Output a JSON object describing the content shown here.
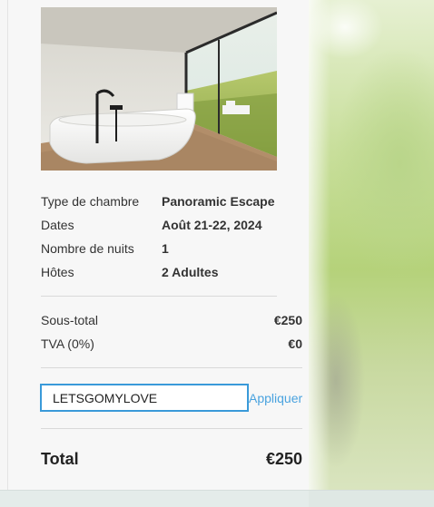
{
  "room": {
    "image_alt": "",
    "details": [
      {
        "label": "Type de chambre",
        "value": "Panoramic Escape"
      },
      {
        "label": "Dates",
        "value": "Août 21-22, 2024"
      },
      {
        "label": "Nombre de nuits",
        "value": "1"
      },
      {
        "label": "Hôtes",
        "value": "2 Adultes"
      }
    ]
  },
  "summary": {
    "subtotal_label": "Sous-total",
    "subtotal_value": "€250",
    "tax_label": "TVA (0%)",
    "tax_value": "€0"
  },
  "promo": {
    "code_value": "LETSGOMYLOVE",
    "apply_label": "Appliquer"
  },
  "total": {
    "label": "Total",
    "value": "€250"
  },
  "colors": {
    "accent": "#3a9ad9",
    "link": "#4aa3df"
  }
}
